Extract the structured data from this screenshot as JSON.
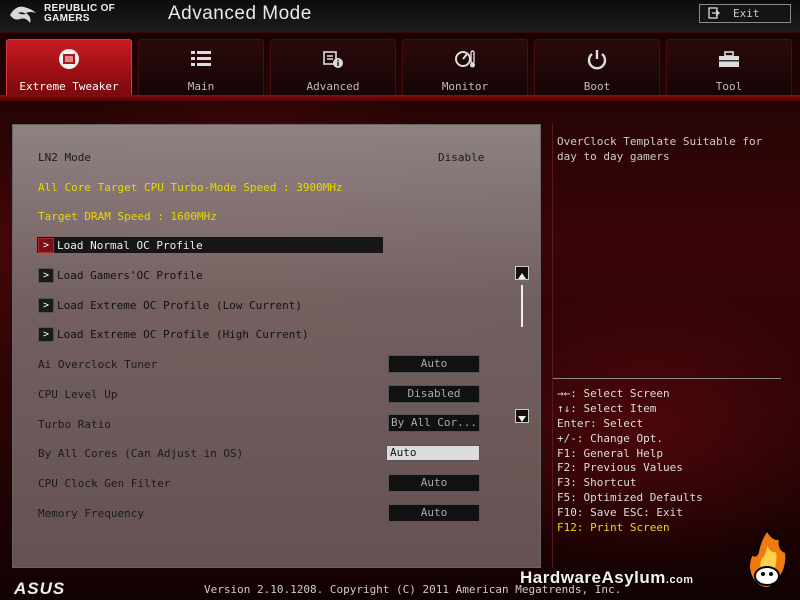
{
  "header": {
    "brand_line1": "REPUBLIC OF",
    "brand_line2": "GAMERS",
    "mode_title": "Advanced Mode",
    "exit_label": "Exit"
  },
  "tabs": [
    {
      "label": "Extreme Tweaker",
      "icon": "tweaker-icon",
      "active": true
    },
    {
      "label": "Main",
      "icon": "list-icon",
      "active": false
    },
    {
      "label": "Advanced",
      "icon": "advanced-info-icon",
      "active": false
    },
    {
      "label": "Monitor",
      "icon": "monitor-gauge-icon",
      "active": false
    },
    {
      "label": "Boot",
      "icon": "power-icon",
      "active": false
    },
    {
      "label": "Tool",
      "icon": "toolbox-icon",
      "active": false
    }
  ],
  "settings": {
    "ln2_label": "LN2 Mode",
    "ln2_value": "Disable",
    "info1": "All Core Target CPU Turbo-Mode Speed : 3900MHz",
    "info2": "Target DRAM Speed : 1600MHz",
    "profiles": [
      "Load Normal OC Profile",
      "Load Gamers'OC Profile",
      "Load Extreme OC Profile (Low Current)",
      "Load Extreme OC Profile (High Current)"
    ],
    "options": [
      {
        "label": "Ai Overclock Tuner",
        "value": "Auto"
      },
      {
        "label": "CPU Level Up",
        "value": "Disabled"
      },
      {
        "label": "Turbo Ratio",
        "value": "By All Cor..."
      },
      {
        "label": "By All Cores (Can Adjust in OS)",
        "value": "Auto"
      },
      {
        "label": "CPU Clock Gen Filter",
        "value": "Auto"
      },
      {
        "label": "Memory Frequency",
        "value": "Auto"
      }
    ]
  },
  "help": {
    "description": "OverClock Template Suitable for day to day gamers",
    "hotkeys": [
      "→←: Select Screen",
      "↑↓: Select Item",
      "Enter: Select",
      "+/-: Change Opt.",
      "F1: General Help",
      "F2: Previous Values",
      "F3: Shortcut",
      "F5: Optimized Defaults",
      "F10: Save  ESC: Exit",
      "F12: Print Screen"
    ]
  },
  "footer": {
    "asus_logo": "ASUS",
    "version": "Version 2.10.1208. Copyright (C) 2011 American Megatrends, Inc.",
    "watermark": "HardwareAsylum",
    "watermark_suffix": ".com"
  },
  "colors": {
    "accent_red": "#c81c22",
    "info_yellow": "#e8d800",
    "hotkey_yellow": "#f0d800"
  }
}
